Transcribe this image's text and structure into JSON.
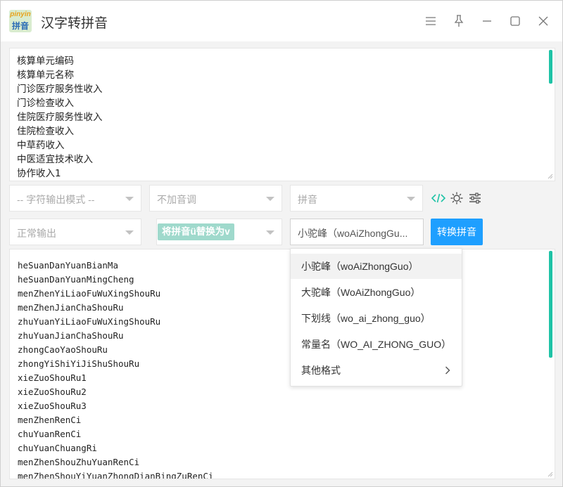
{
  "app": {
    "title": "汉字转拼音",
    "logo_top": "pinyin",
    "logo_bottom": "拼音"
  },
  "input": {
    "lines": [
      "核算单元编码",
      "核算单元名称",
      "门诊医疗服务性收入",
      "门诊检查收入",
      "住院医疗服务性收入",
      "住院检查收入",
      "中草药收入",
      "中医适宜技术收入",
      "协作收入1"
    ]
  },
  "options_row1": {
    "char_mode_placeholder": "-- 字符输出模式 --",
    "tone_value": "不加音调",
    "pinyin_value": "拼音"
  },
  "options_row2": {
    "output_mode_value": "正常输出",
    "v_replace_tag": "将拼音ü替换为v",
    "format_value": "小驼峰（woAiZhongGu...",
    "convert_label": "转换拼音"
  },
  "format_menu": {
    "items": [
      "小驼峰（woAiZhongGuo）",
      "大驼峰（WoAiZhongGuo）",
      "下划线（wo_ai_zhong_guo）",
      "常量名（WO_AI_ZHONG_GUO）",
      "其他格式"
    ],
    "selected_index": 0
  },
  "output": {
    "lines": [
      "heSuanDanYuanBianMa",
      "heSuanDanYuanMingCheng",
      "menZhenYiLiaoFuWuXingShouRu",
      "menZhenJianChaShouRu",
      "zhuYuanYiLiaoFuWuXingShouRu",
      "zhuYuanJianChaShouRu",
      "zhongCaoYaoShouRu",
      "zhongYiShiYiJiShuShouRu",
      "xieZuoShouRu1",
      "xieZuoShouRu2",
      "xieZuoShouRu3",
      "menZhenRenCi",
      "chuYuanRenCi",
      "chuYuanChuangRi",
      "menZhenShouZhuYuanRenCi",
      "menZhenShouYiYuanZhongDianBingZuRenCi"
    ]
  },
  "colors": {
    "accent_teal": "#1fc3a6",
    "primary_blue": "#1e9fff",
    "tag_bg": "#9fd9cc"
  }
}
